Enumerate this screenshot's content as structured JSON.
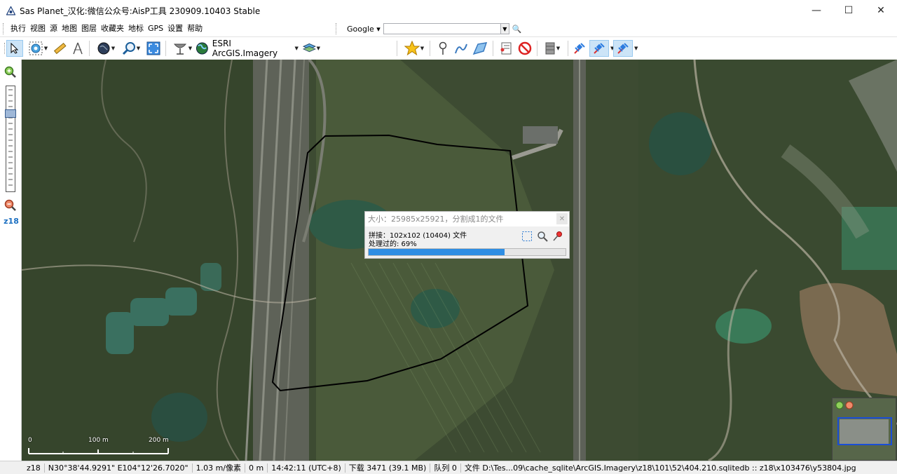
{
  "window": {
    "title": "Sas Planet_汉化:微信公众号:AisP工具 230909.10403 Stable",
    "minimize": "—",
    "maximize": "☐",
    "close": "✕"
  },
  "menu": [
    "执行",
    "视图",
    "源",
    "地图",
    "图层",
    "收藏夹",
    "地标",
    "GPS",
    "设置",
    "帮助"
  ],
  "search": {
    "engine": "Google ▾",
    "value": "",
    "go": "🔍"
  },
  "toolbar": {
    "map_source": "ESRI ArcGIS.Imagery"
  },
  "left_panel": {
    "zoom_level": "z18"
  },
  "dialog": {
    "title": "大小：25985x25921，分割成1的文件",
    "line1": "拼接：102x102 (10404) 文件",
    "line2": "处理过的: 69%",
    "progress": 0.69,
    "close": "✕"
  },
  "scale": {
    "zero": "0",
    "mid": "100 m",
    "end": "200 m"
  },
  "status": {
    "zoom": "z18",
    "coords": "N30°38'44.9291\" E104°12'26.7020\"",
    "resolution": "1.03 m/像素",
    "distance": "0 m",
    "time": "14:42:11 (UTC+8)",
    "download": "下载 3471 (39.1 MB)",
    "queue": "队列 0",
    "file": "文件 D:\\Tes...09\\cache_sqlite\\ArcGIS.Imagery\\z18\\101\\52\\404.210.sqlitedb :: z18\\x103476\\y53804.jpg"
  },
  "colors": {
    "progress": "#2f8ee3",
    "selection_border": "#000000",
    "active_tool": "#cce4f7"
  }
}
